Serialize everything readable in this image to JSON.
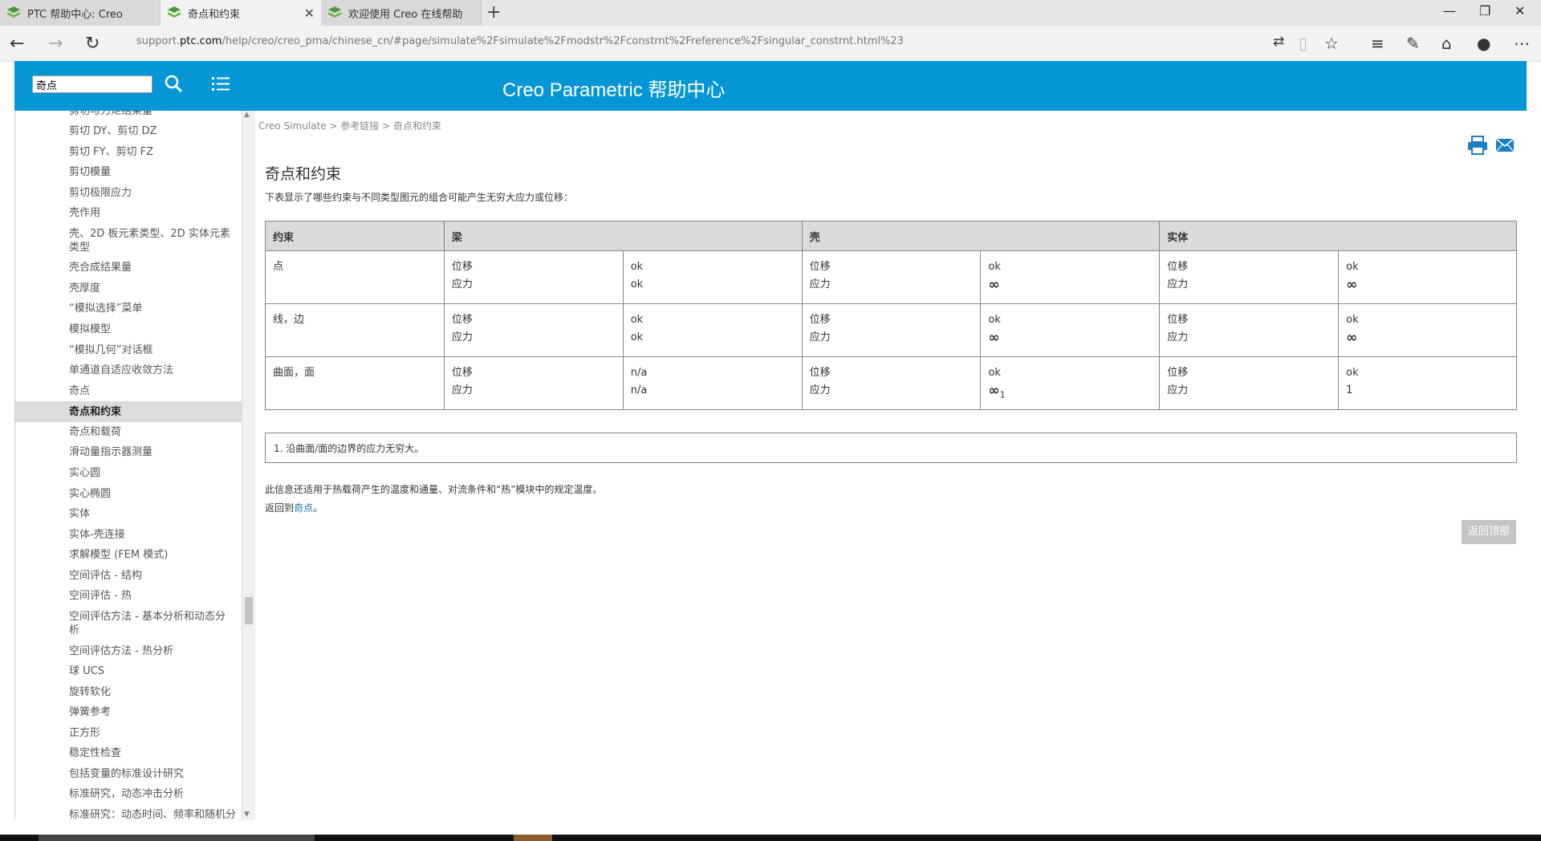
{
  "browser": {
    "tabs": [
      {
        "title": "PTC 帮助中心: Creo",
        "active": false
      },
      {
        "title": "奇点和约束",
        "active": true
      },
      {
        "title": "欢迎使用 Creo 在线帮助",
        "active": false
      }
    ],
    "new_tab": "+",
    "url_prefix": "support.",
    "url_domain": "ptc.com",
    "url_path": "/help/creo/creo_pma/chinese_cn/#page/simulate%2Fsimulate%2Fmodstr%2Fconstrnt%2Freference%2Fsingular_constrnt.html%23",
    "controls": {
      "minimize": "—",
      "restore": "❐",
      "close": "✕"
    }
  },
  "header": {
    "search_value": "奇点",
    "title": "Creo Parametric 帮助中心"
  },
  "sidebar": {
    "items": [
      {
        "label": "剪切与力矩结果量",
        "active": false
      },
      {
        "label": "剪切 DY、剪切 DZ",
        "active": false
      },
      {
        "label": "剪切 FY、剪切 FZ",
        "active": false
      },
      {
        "label": "剪切模量",
        "active": false
      },
      {
        "label": "剪切极限应力",
        "active": false
      },
      {
        "label": "壳作用",
        "active": false
      },
      {
        "label": "壳、2D 板元素类型、2D 实体元素类型",
        "active": false
      },
      {
        "label": "壳合成结果量",
        "active": false
      },
      {
        "label": "壳厚度",
        "active": false
      },
      {
        "label": "“模拟选择”菜单",
        "active": false
      },
      {
        "label": "模拟模型",
        "active": false
      },
      {
        "label": "“模拟几何”对话框",
        "active": false
      },
      {
        "label": "单通道自适应收敛方法",
        "active": false
      },
      {
        "label": "奇点",
        "active": false
      },
      {
        "label": "奇点和约束",
        "active": true
      },
      {
        "label": "奇点和载荷",
        "active": false
      },
      {
        "label": "滑动量指示器测量",
        "active": false
      },
      {
        "label": "实心圆",
        "active": false
      },
      {
        "label": "实心椭圆",
        "active": false
      },
      {
        "label": "实体",
        "active": false
      },
      {
        "label": "实体-壳连接",
        "active": false
      },
      {
        "label": "求解模型 (FEM 模式)",
        "active": false
      },
      {
        "label": "空间评估 - 结构",
        "active": false
      },
      {
        "label": "空间评估 - 热",
        "active": false
      },
      {
        "label": "空间评估方法 - 基本分析和动态分析",
        "active": false
      },
      {
        "label": "空间评估方法 - 热分析",
        "active": false
      },
      {
        "label": "球 UCS",
        "active": false
      },
      {
        "label": "旋转软化",
        "active": false
      },
      {
        "label": "弹簧参考",
        "active": false
      },
      {
        "label": "正方形",
        "active": false
      },
      {
        "label": "稳定性检查",
        "active": false
      },
      {
        "label": "包括变量的标准设计研究",
        "active": false
      },
      {
        "label": "标准研究，动态冲击分析",
        "active": false
      },
      {
        "label": "标准研究：动态时间、频率和随机分",
        "active": false
      }
    ]
  },
  "main": {
    "breadcrumb": "Creo Simulate > 参考链接 > 奇点和约束",
    "title": "奇点和约束",
    "intro": "下表显示了哪些约束与不同类型图元的组合可能产生无穷大应力或位移：",
    "table": {
      "headers": [
        "约束",
        "梁",
        "壳",
        "实体"
      ],
      "rows": [
        {
          "constraint": "点",
          "beam": [
            "位移",
            "应力",
            "ok",
            "ok"
          ],
          "shell": [
            "位移",
            "应力",
            "ok",
            "∞",
            ""
          ],
          "solid": [
            "位移",
            "应力",
            "ok",
            "∞",
            ""
          ]
        },
        {
          "constraint": "线，边",
          "beam": [
            "位移",
            "应力",
            "ok",
            "ok"
          ],
          "shell": [
            "位移",
            "应力",
            "ok",
            "∞",
            ""
          ],
          "solid": [
            "位移",
            "应力",
            "ok",
            "∞",
            ""
          ]
        },
        {
          "constraint": "曲面，面",
          "beam": [
            "位移",
            "应力",
            "n/a",
            "n/a"
          ],
          "shell": [
            "位移",
            "应力",
            "ok",
            "∞",
            "1"
          ],
          "solid": [
            "位移",
            "应力",
            "ok",
            "1",
            ""
          ]
        }
      ]
    },
    "footnote": "1. 沿曲面/面的边界的应力无穷大。",
    "note": "此信息还适用于热载荷产生的温度和通量、对流条件和“热”模块中的规定温度。",
    "return_prefix": "返回到",
    "return_link": "奇点",
    "return_suffix": "。",
    "back_to_top": "返回顶部"
  }
}
